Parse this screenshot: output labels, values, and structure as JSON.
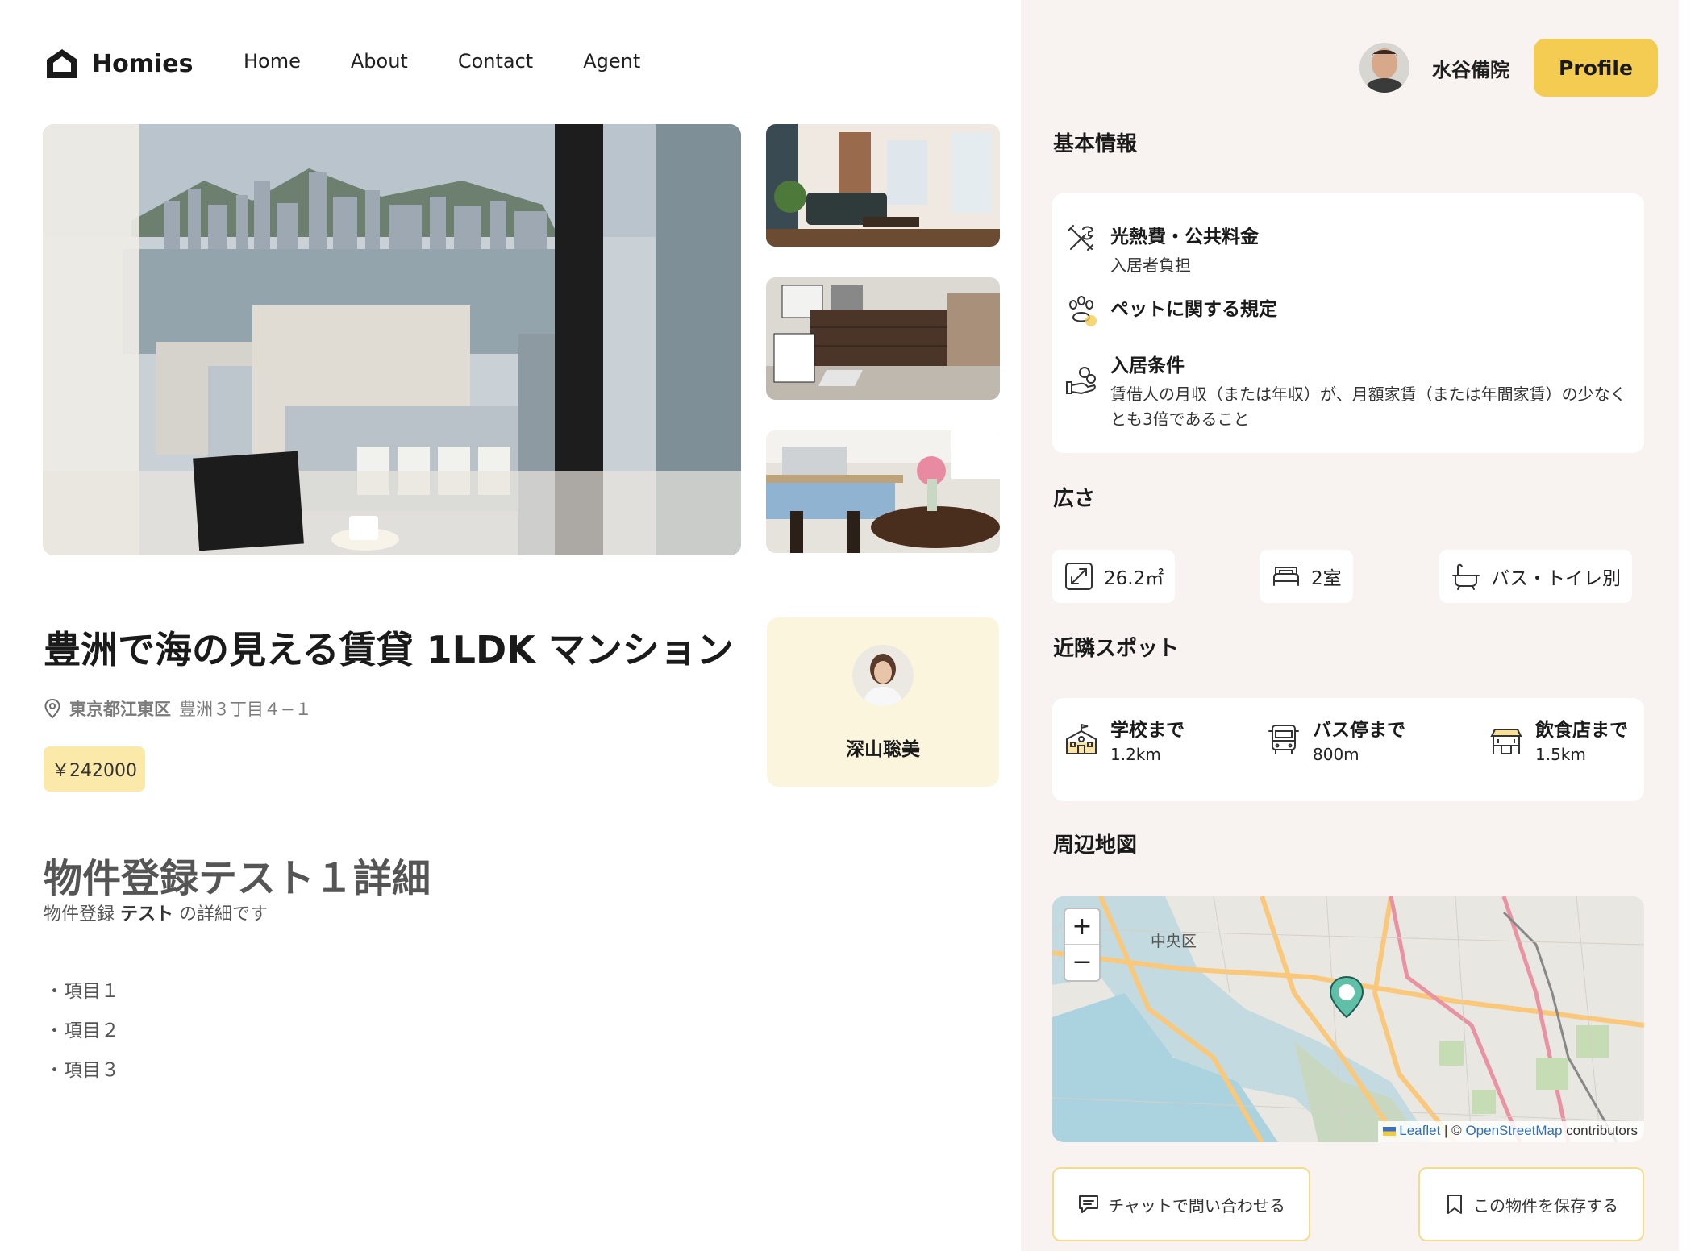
{
  "header": {
    "brand": "Homies",
    "nav": [
      "Home",
      "About",
      "Contact",
      "Agent"
    ],
    "user_name": "水谷備院",
    "profile_label": "Profile"
  },
  "listing": {
    "title": "豊洲で海の見える賃貸 1LDK マンション",
    "address_bold": "東京都江東区",
    "address_rest": "豊洲３丁目４−１",
    "price": "￥242000"
  },
  "agent": {
    "name": "深山聡美"
  },
  "detail": {
    "title": "物件登録テスト１詳細",
    "sub_prefix": "物件登録",
    "sub_bold": "テスト",
    "sub_suffix": "の詳細です",
    "items": [
      "・項目１",
      "・項目２",
      "・項目３"
    ]
  },
  "basic_info": {
    "title": "基本情報",
    "rows": [
      {
        "icon": "tools-icon",
        "label": "光熱費・公共料金",
        "value": "入居者負担"
      },
      {
        "icon": "paw-icon",
        "label": "ペットに関する規定",
        "value": ""
      },
      {
        "icon": "hand-coins-icon",
        "label": "入居条件",
        "value": "賃借人の月収（または年収）が、月額家賃（または年間家賃）の少なくとも3倍であること"
      }
    ]
  },
  "size": {
    "title": "広さ",
    "area": "26.2㎡",
    "rooms": "2室",
    "bath": "バス・トイレ別"
  },
  "spots": {
    "title": "近隣スポット",
    "items": [
      {
        "icon": "school-icon",
        "label": "学校まで",
        "dist": "1.2km"
      },
      {
        "icon": "bus-icon",
        "label": "バス停まで",
        "dist": "800m"
      },
      {
        "icon": "restaurant-icon",
        "label": "飲食店まで",
        "dist": "1.5km"
      }
    ]
  },
  "map": {
    "title": "周辺地図",
    "zoom_in": "+",
    "zoom_out": "−",
    "district": "中央区",
    "attrib_leaflet": "Leaflet",
    "attrib_sep": " | © ",
    "attrib_osm": "OpenStreetMap",
    "attrib_suffix": " contributors"
  },
  "actions": {
    "chat": "チャットで問い合わせる",
    "save": "この物件を保存する"
  },
  "colors": {
    "accent": "#f4cc52",
    "price_bg": "#fbe9a9",
    "agent_bg": "#fcf5de",
    "sidebar_bg": "#f8f3f0"
  }
}
